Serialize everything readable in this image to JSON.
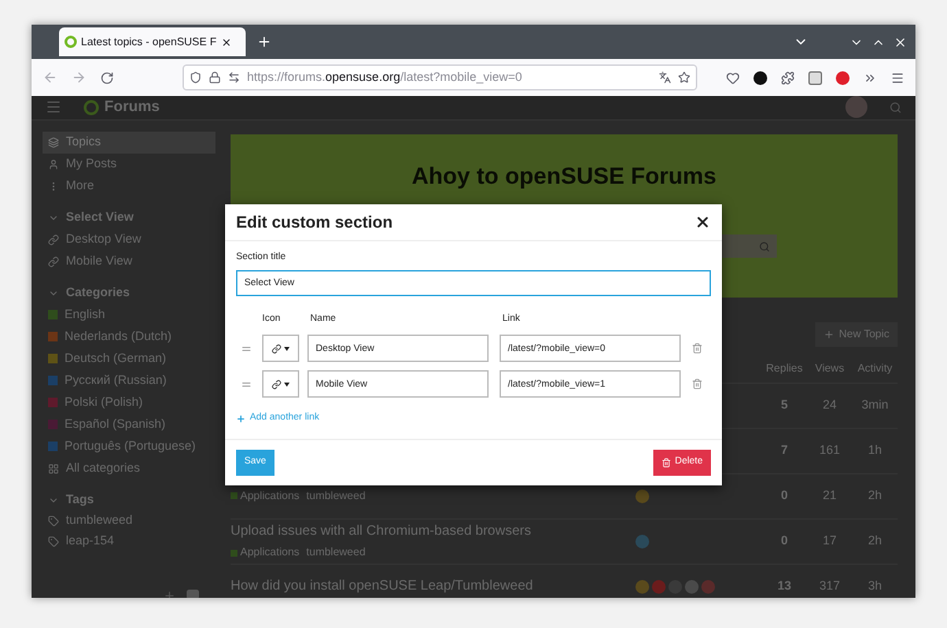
{
  "browser": {
    "tab_title": "Latest topics - openSUSE F",
    "url_prefix": "https://forums.",
    "url_domain": "opensuse.org",
    "url_path": "/latest?mobile_view=0"
  },
  "header": {
    "title": "Forums"
  },
  "sidebar": {
    "nav": [
      {
        "label": "Topics",
        "selected": true
      },
      {
        "label": "My Posts",
        "selected": false
      },
      {
        "label": "More",
        "selected": false
      }
    ],
    "select_view": {
      "title": "Select View",
      "links": [
        "Desktop View",
        "Mobile View"
      ]
    },
    "categories": {
      "title": "Categories",
      "items": [
        {
          "label": "English",
          "color": "#2f4d1c"
        },
        {
          "label": "Nederlands (Dutch)",
          "color": "#6b3516"
        },
        {
          "label": "Deutsch (German)",
          "color": "#5e5216"
        },
        {
          "label": "Русский (Russian)",
          "color": "#1b3f66"
        },
        {
          "label": "Polski (Polish)",
          "color": "#5f1a2c"
        },
        {
          "label": "Español (Spanish)",
          "color": "#4a1a35"
        },
        {
          "label": "Português (Portuguese)",
          "color": "#1b3f66"
        }
      ],
      "all_label": "All categories"
    },
    "tags": {
      "title": "Tags",
      "items": [
        "tumbleweed",
        "leap-154"
      ]
    }
  },
  "main": {
    "banner_title": "Ahoy to openSUSE Forums",
    "new_topic": "New Topic",
    "columns": [
      "Replies",
      "Views",
      "Activity"
    ],
    "rows": [
      {
        "title": "",
        "tags": [],
        "posters": [],
        "replies": "5",
        "views": "24",
        "activity": "3min"
      },
      {
        "title": "",
        "tags": [],
        "posters": [],
        "replies": "7",
        "views": "161",
        "activity": "1h"
      },
      {
        "title": "",
        "tags": [
          "Applications",
          "tumbleweed"
        ],
        "posters": [
          {
            "color": "#5a4a1c"
          }
        ],
        "replies": "0",
        "views": "21",
        "activity": "2h"
      },
      {
        "title": "Upload issues with all Chromium-based browsers",
        "tags": [
          "Applications",
          "tumbleweed"
        ],
        "posters": [
          {
            "color": "#2a4a5a"
          }
        ],
        "replies": "0",
        "views": "17",
        "activity": "2h"
      },
      {
        "title": "How did you install openSUSE Leap/Tumbleweed",
        "tags": [],
        "posters": [
          {
            "color": "#5a4a1c"
          },
          {
            "color": "#6b1c1c"
          },
          {
            "color": "#3a3a3a"
          },
          {
            "color": "#4a4a4a"
          },
          {
            "color": "#5a2a2a"
          }
        ],
        "replies": "13",
        "views": "317",
        "activity": "3h"
      }
    ]
  },
  "modal": {
    "title": "Edit custom section",
    "section_label": "Section title",
    "section_value": "Select View",
    "columns": [
      "Icon",
      "Name",
      "Link"
    ],
    "links": [
      {
        "name": "Desktop View",
        "link": "/latest/?mobile_view=0"
      },
      {
        "name": "Mobile View",
        "link": "/latest/?mobile_view=1"
      }
    ],
    "add_link": "Add another link",
    "save": "Save",
    "delete": "Delete"
  }
}
